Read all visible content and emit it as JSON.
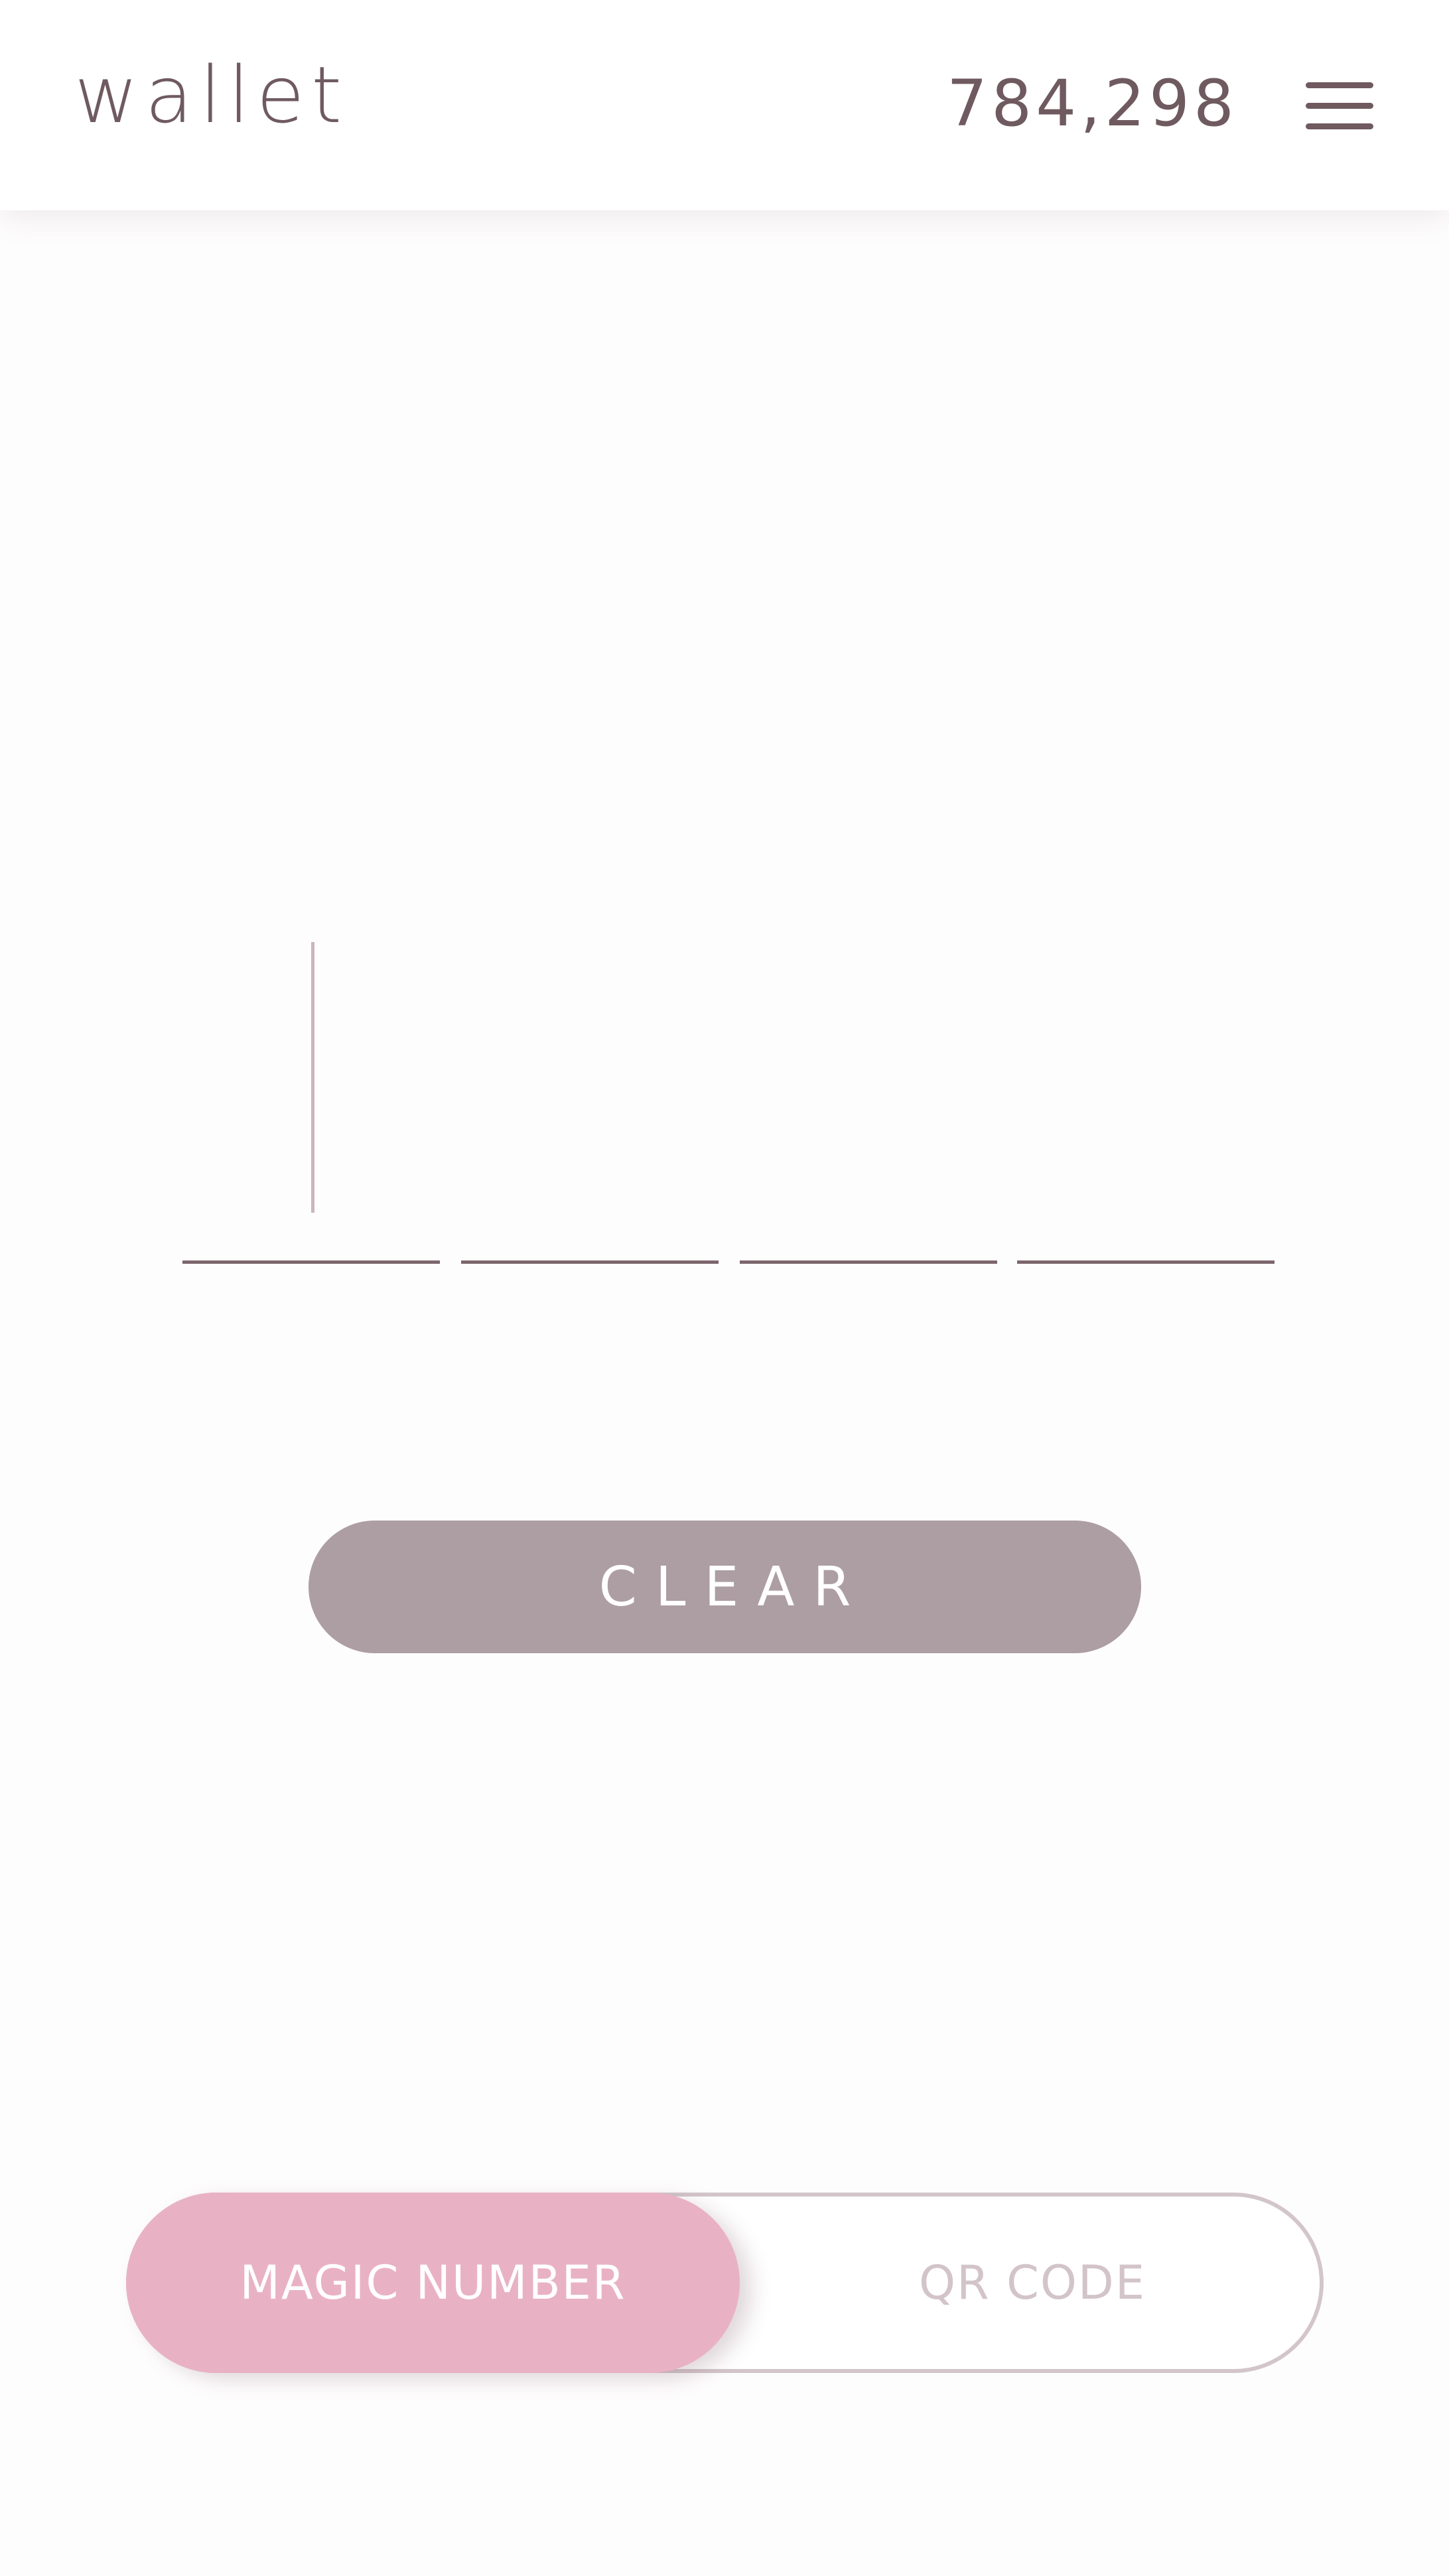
{
  "header": {
    "logo": "wallet",
    "balance": "784,298",
    "menu_icon": "hamburger-menu-icon"
  },
  "code_entry": {
    "digits": [
      "",
      "",
      "",
      ""
    ]
  },
  "clear_button": {
    "label": "CLEAR"
  },
  "mode_toggle": {
    "options": [
      {
        "label": "MAGIC NUMBER",
        "active": true
      },
      {
        "label": "QR CODE",
        "active": false
      }
    ]
  },
  "colors": {
    "text_primary": "#6f5a60",
    "clear_button": "#ad9ea3",
    "toggle_active": "#e9b2c4",
    "toggle_border": "#d3c6ca",
    "toggle_inactive_text": "#d2c4c8"
  }
}
